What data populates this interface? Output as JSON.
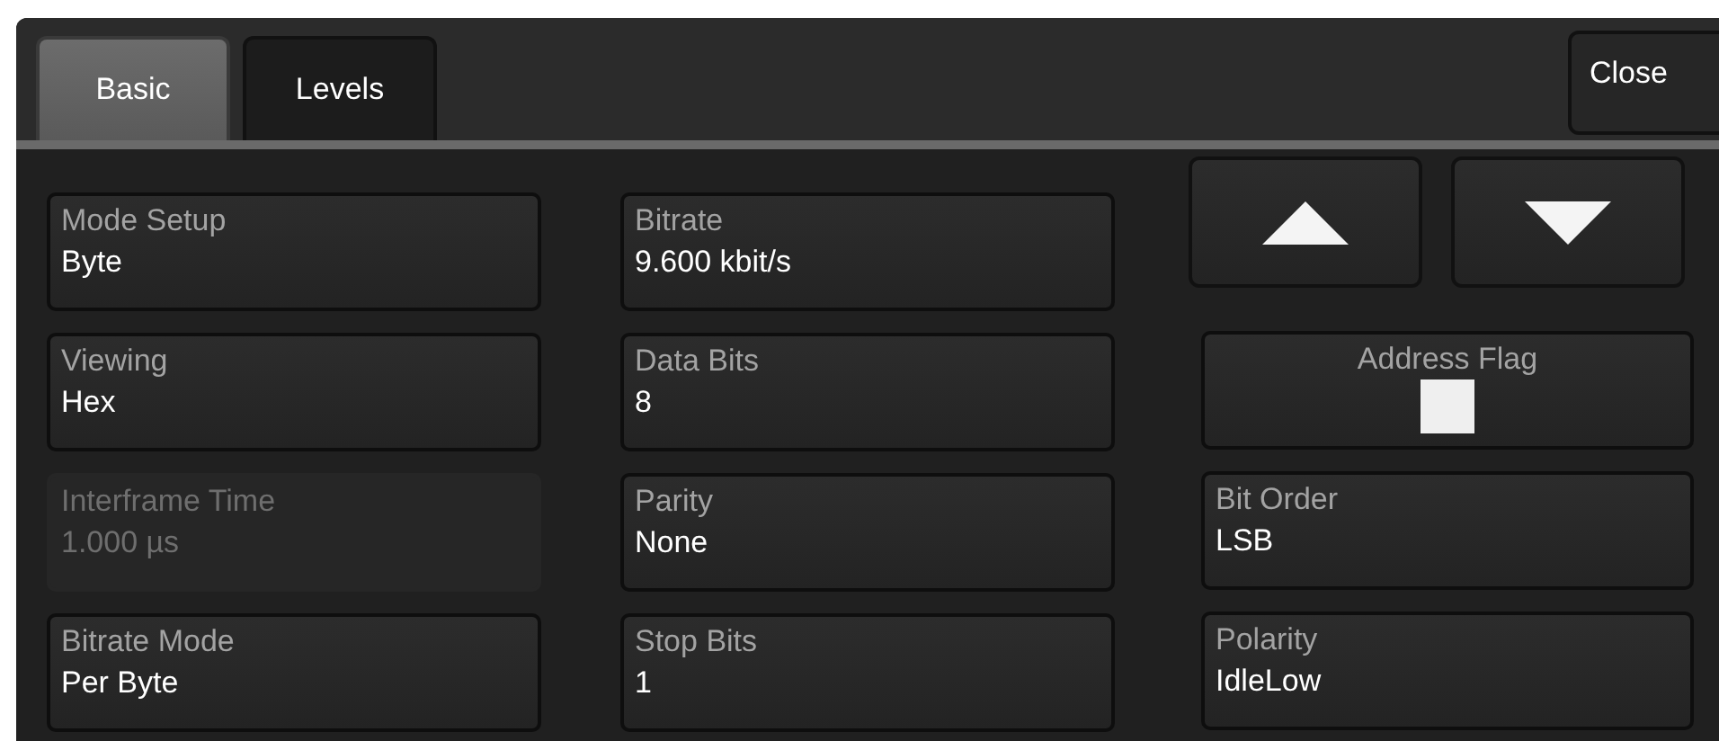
{
  "tabs": [
    {
      "label": "Basic",
      "selected": true
    },
    {
      "label": "Levels",
      "selected": false
    }
  ],
  "close_button": {
    "label": "Close"
  },
  "columns": [
    [
      {
        "kind": "value",
        "label": "Mode Setup",
        "value": "Byte",
        "disabled": false
      },
      {
        "kind": "value",
        "label": "Viewing",
        "value": "Hex",
        "disabled": false
      },
      {
        "kind": "value",
        "label": "Interframe Time",
        "value": "1.000 µs",
        "disabled": true
      },
      {
        "kind": "value",
        "label": "Bitrate Mode",
        "value": "Per Byte",
        "disabled": false
      }
    ],
    [
      {
        "kind": "value",
        "label": "Bitrate",
        "value": "9.600 kbit/s",
        "disabled": false
      },
      {
        "kind": "value",
        "label": "Data Bits",
        "value": "8",
        "disabled": false
      },
      {
        "kind": "value",
        "label": "Parity",
        "value": "None",
        "disabled": false
      },
      {
        "kind": "value",
        "label": "Stop Bits",
        "value": "1",
        "disabled": false
      }
    ],
    [
      {
        "kind": "checkbox",
        "label": "Address Flag",
        "checked": false
      },
      {
        "kind": "value",
        "label": "Bit Order",
        "value": "LSB",
        "disabled": false
      },
      {
        "kind": "value",
        "label": "Polarity",
        "value": "IdleLow",
        "disabled": false
      }
    ]
  ],
  "scroll_buttons": [
    {
      "kind": "up"
    },
    {
      "kind": "down"
    }
  ]
}
